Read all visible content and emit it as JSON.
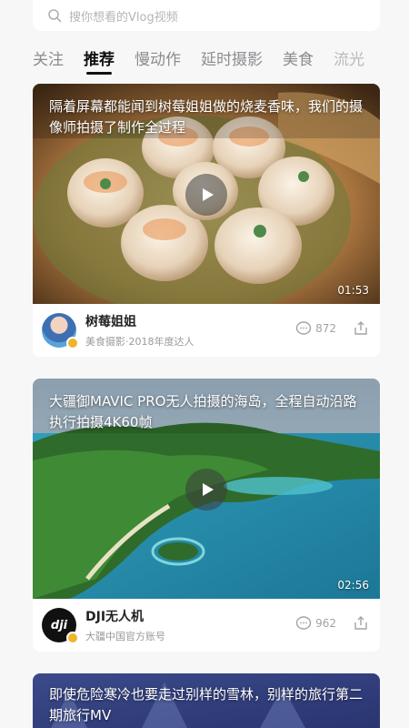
{
  "search": {
    "placeholder": "搜你想看的Vlog视频"
  },
  "tabs": [
    {
      "label": "关注"
    },
    {
      "label": "推荐"
    },
    {
      "label": "慢动作"
    },
    {
      "label": "延时摄影"
    },
    {
      "label": "美食"
    },
    {
      "label": "流光"
    }
  ],
  "active_tab": "推荐",
  "feed": [
    {
      "title": "隔着屏幕都能闻到树莓姐姐做的烧麦香味，我们的摄像师拍摄了制作全过程",
      "duration": "01:53",
      "author": "树莓姐姐",
      "author_desc": "美食摄影·2018年度达人",
      "comments": "872"
    },
    {
      "title": "大疆御MAVIC PRO无人拍摄的海岛，全程自动沿路执行拍摄4K60帧",
      "duration": "02:56",
      "author": "DJI无人机",
      "author_desc": "大疆中国官方账号",
      "avatar_text": "dji",
      "comments": "962"
    },
    {
      "title": "即使危险寒冷也要走过别样的雪林，别样的旅行第二期旅行MV"
    }
  ],
  "colors": {
    "badge": "#f0b429",
    "active_tab": "#111111"
  }
}
